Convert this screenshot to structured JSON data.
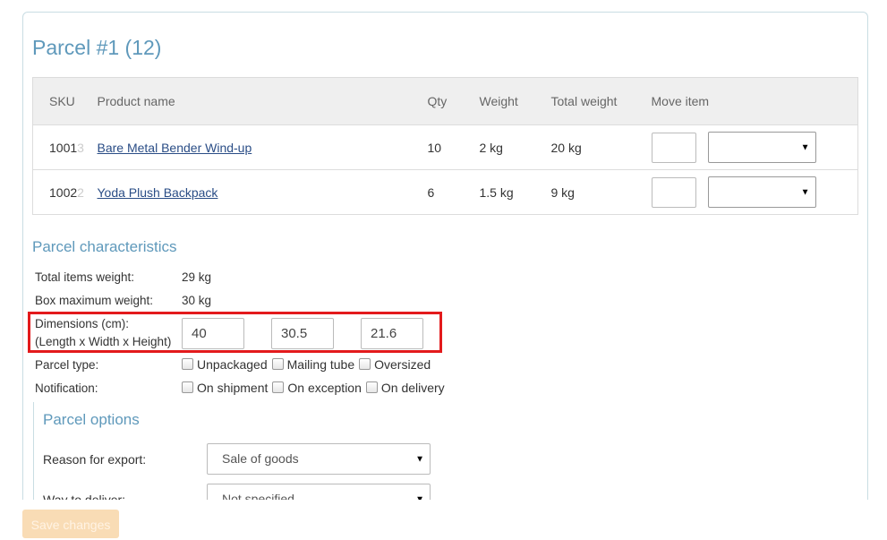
{
  "parcel": {
    "title": "Parcel #1 (12)"
  },
  "table": {
    "headers": {
      "sku": "SKU",
      "name": "Product name",
      "qty": "Qty",
      "weight": "Weight",
      "total_weight": "Total weight",
      "move": "Move item"
    },
    "rows": [
      {
        "sku": "1001",
        "sku_tail": "3",
        "name": "Bare Metal Bender Wind-up",
        "qty": "10",
        "weight": "2 kg",
        "total_weight": "20 kg",
        "move_qty": "",
        "move_target": ""
      },
      {
        "sku": "1002",
        "sku_tail": "2",
        "name": "Yoda Plush Backpack",
        "qty": "6",
        "weight": "1.5 kg",
        "total_weight": "9 kg",
        "move_qty": "",
        "move_target": ""
      }
    ]
  },
  "characteristics": {
    "title": "Parcel characteristics",
    "total_weight_label": "Total items weight:",
    "total_weight_value": "29 kg",
    "max_weight_label": "Box maximum weight:",
    "max_weight_value": "30 kg",
    "dimensions_label_1": "Dimensions (cm):",
    "dimensions_label_2": "(Length x Width x Height)",
    "length": "40",
    "width": "30.5",
    "height": "21.6",
    "parcel_type_label": "Parcel type:",
    "parcel_types": [
      "Unpackaged",
      "Mailing tube",
      "Oversized"
    ],
    "notification_label": "Notification:",
    "notifications": [
      "On shipment",
      "On exception",
      "On delivery"
    ]
  },
  "options": {
    "title": "Parcel options",
    "reason_label": "Reason for export:",
    "reason_value": "Sale of goods",
    "deliver_label": "Way to deliver:",
    "deliver_value": "Not specified"
  },
  "actions": {
    "save_label": "Save changes"
  },
  "colors": {
    "accent": "#5f99bb",
    "link": "#2a4d86",
    "highlight": "#e31a1c",
    "save_button": "#f9dcb5"
  }
}
